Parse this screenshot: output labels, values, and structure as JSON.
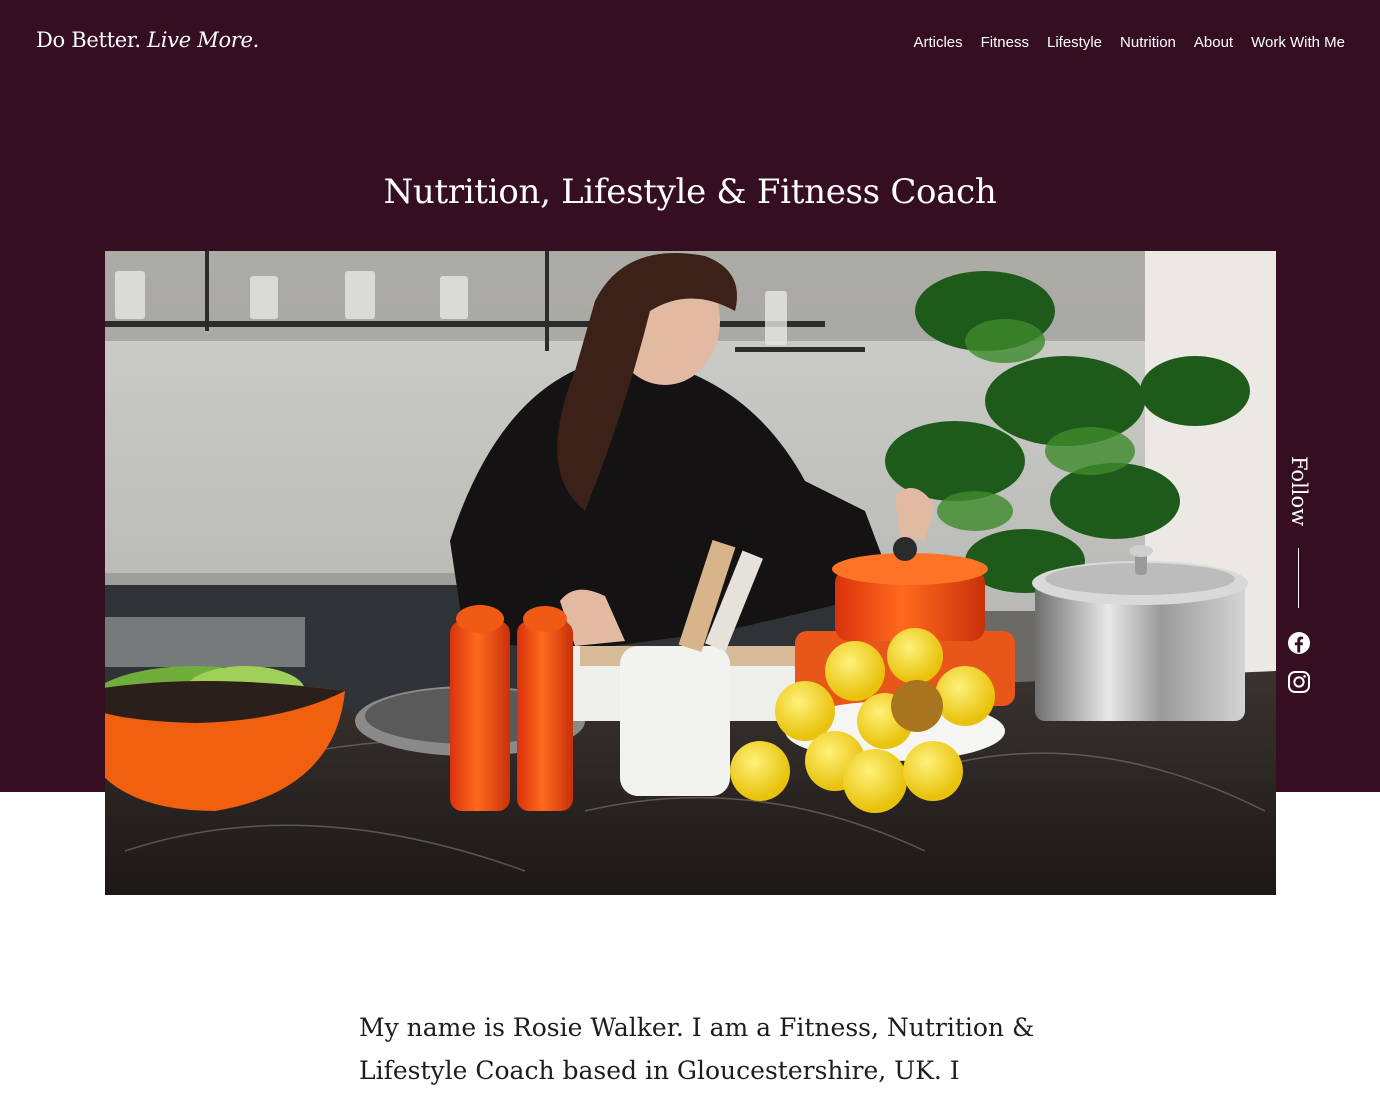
{
  "header": {
    "logo_regular": "Do Better.",
    "logo_italic": "Live More.",
    "nav": [
      {
        "label": "Articles"
      },
      {
        "label": "Fitness"
      },
      {
        "label": "Lifestyle"
      },
      {
        "label": "Nutrition"
      },
      {
        "label": "About"
      },
      {
        "label": "Work With Me"
      }
    ]
  },
  "hero": {
    "title": "Nutrition, Lifestyle & Fitness Coach"
  },
  "follow": {
    "label": "Follow",
    "icons": [
      "facebook-icon",
      "instagram-icon"
    ]
  },
  "intro": {
    "text": "My name is Rosie Walker. I am a Fitness, Nutrition & Lifestyle Coach based in Gloucestershire, UK. I"
  },
  "colors": {
    "brand_background": "#350f21",
    "text_light": "#ffffff",
    "text_dark": "#1d1d1d"
  }
}
